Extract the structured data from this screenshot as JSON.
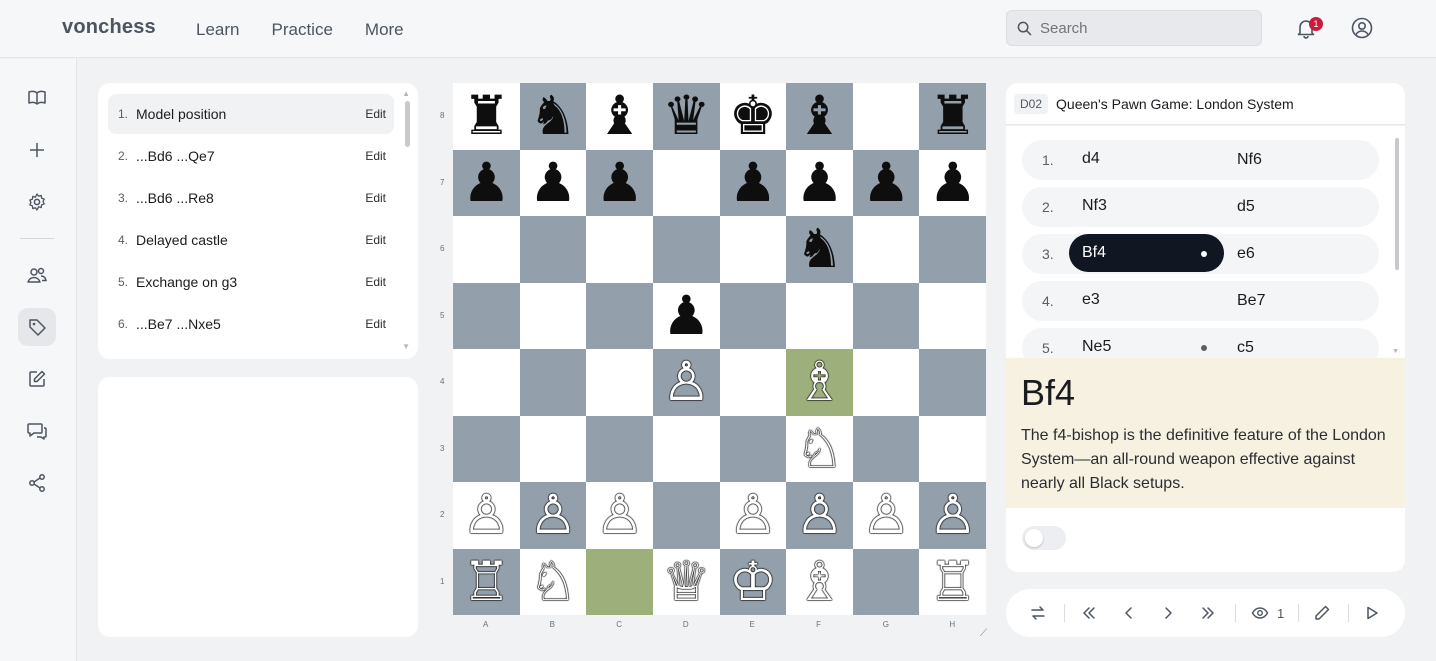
{
  "brand": "vonchess",
  "nav": [
    "Learn",
    "Practice",
    "More"
  ],
  "search": {
    "placeholder": "Search"
  },
  "notifications": {
    "count": "1"
  },
  "lines": [
    {
      "num": "1.",
      "name": "Model position",
      "edit": "Edit",
      "selected": true
    },
    {
      "num": "2.",
      "name": "...Bd6 ...Qe7",
      "edit": "Edit"
    },
    {
      "num": "3.",
      "name": "...Bd6 ...Re8",
      "edit": "Edit"
    },
    {
      "num": "4.",
      "name": "Delayed castle",
      "edit": "Edit"
    },
    {
      "num": "5.",
      "name": "Exchange on g3",
      "edit": "Edit"
    },
    {
      "num": "6.",
      "name": "...Be7 ...Nxe5",
      "edit": "Edit"
    }
  ],
  "board": {
    "ranks": [
      "8",
      "7",
      "6",
      "5",
      "4",
      "3",
      "2",
      "1"
    ],
    "files": [
      "A",
      "B",
      "C",
      "D",
      "E",
      "F",
      "G",
      "H"
    ],
    "rows": [
      [
        "♜",
        "♞",
        "♝",
        "♛",
        "♚",
        "♝",
        "",
        "♜"
      ],
      [
        "♟",
        "♟",
        "♟",
        "",
        "♟",
        "♟",
        "♟",
        "♟"
      ],
      [
        "",
        "",
        "",
        "",
        "",
        "♞",
        "",
        ""
      ],
      [
        "",
        "",
        "",
        "♟",
        "",
        "",
        "",
        ""
      ],
      [
        "",
        "",
        "",
        "♙",
        "",
        "♗",
        "",
        ""
      ],
      [
        "",
        "",
        "",
        "",
        "",
        "♘",
        "",
        ""
      ],
      [
        "♙",
        "♙",
        "♙",
        "",
        "♙",
        "♙",
        "♙",
        "♙"
      ],
      [
        "♖",
        "♘",
        "",
        "♕",
        "♔",
        "♗",
        "",
        "♖"
      ]
    ],
    "highlights": [
      "f4",
      "c1"
    ],
    "colors": {
      "light": "#ffffff",
      "dark": "#939fab",
      "highlight": "#9daf7b"
    }
  },
  "opening": {
    "eco": "D02",
    "name": "Queen's Pawn Game: London System"
  },
  "moves": [
    {
      "num": "1.",
      "white": "d4",
      "black": "Nf6"
    },
    {
      "num": "2.",
      "white": "Nf3",
      "black": "d5"
    },
    {
      "num": "3.",
      "white": "Bf4",
      "black": "e6",
      "active": true,
      "dot": true
    },
    {
      "num": "4.",
      "white": "e3",
      "black": "Be7"
    },
    {
      "num": "5.",
      "white": "Ne5",
      "black": "c5",
      "dot": true
    }
  ],
  "annotation": {
    "move": "Bf4",
    "text": "The f4-bishop is the definitive feature of the London System—an all-round weapon effective against nearly all Black setups."
  },
  "controls": {
    "view_count": "1"
  }
}
